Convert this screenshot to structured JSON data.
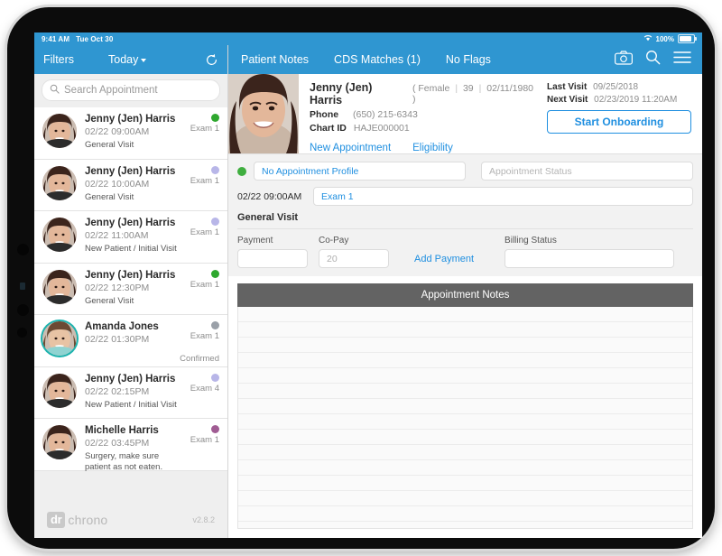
{
  "status_bar": {
    "time": "9:41 AM",
    "date": "Tue Oct 30",
    "wifi_icon": "wifi-icon",
    "battery_percent": "100%"
  },
  "sidebar": {
    "toolbar": {
      "filters_label": "Filters",
      "today_label": "Today",
      "chevron_icon": "chevron-down-icon",
      "refresh_icon": "refresh-icon"
    },
    "search": {
      "placeholder": "Search Appointment",
      "value": "",
      "icon": "search-icon"
    },
    "appointments": [
      {
        "name": "Jenny (Jen) Harris",
        "time": "02/22 09:00AM",
        "reason": "General Visit",
        "room": "Exam 1",
        "status_color": "#2fa82f",
        "confirmed": "",
        "avatar": "patient-avatar",
        "selected": false
      },
      {
        "name": "Jenny (Jen) Harris",
        "time": "02/22 10:00AM",
        "reason": "General Visit",
        "room": "Exam 1",
        "status_color": "#b8b6e8",
        "confirmed": "",
        "avatar": "patient-avatar",
        "selected": false
      },
      {
        "name": "Jenny (Jen) Harris",
        "time": "02/22 11:00AM",
        "reason": "New Patient / Initial Visit",
        "room": "Exam 1",
        "status_color": "#b8b6e8",
        "confirmed": "",
        "avatar": "patient-avatar",
        "selected": false
      },
      {
        "name": "Jenny (Jen) Harris",
        "time": "02/22 12:30PM",
        "reason": "General Visit",
        "room": "Exam 1",
        "status_color": "#2fa82f",
        "confirmed": "",
        "avatar": "patient-avatar",
        "selected": false
      },
      {
        "name": "Amanda Jones",
        "time": "02/22 01:30PM",
        "reason": "",
        "room": "Exam 1",
        "status_color": "#9aa0a8",
        "confirmed": "Confirmed",
        "avatar": "patient-avatar-ringed",
        "selected": true
      },
      {
        "name": "Jenny (Jen) Harris",
        "time": "02/22 02:15PM",
        "reason": "New Patient / Initial Visit",
        "room": "Exam 4",
        "status_color": "#b8b6e8",
        "confirmed": "",
        "avatar": "patient-avatar",
        "selected": false
      },
      {
        "name": "Michelle Harris",
        "time": "02/22 03:45PM",
        "reason": "Surgery, make sure\npatient as not eaten.",
        "room": "Exam 1",
        "status_color": "#a05c93",
        "confirmed": "",
        "avatar": "patient-avatar",
        "selected": false
      }
    ],
    "footer": {
      "logo_dr": "dr",
      "logo_chrono": "chrono",
      "version": "v2.8.2"
    }
  },
  "main": {
    "toolbar": {
      "tabs": [
        {
          "label": "Patient Notes"
        },
        {
          "label": "CDS Matches (1)"
        },
        {
          "label": "No Flags"
        }
      ],
      "camera_icon": "camera-icon",
      "search_icon": "search-icon",
      "menu_icon": "hamburger-menu-icon"
    },
    "patient": {
      "photo": "patient-photo",
      "name": "Jenny (Jen) Harris",
      "demographics_open": "(",
      "gender": "Female",
      "age": "39",
      "dob": "02/11/1980",
      "demographics_close": ")",
      "phone_label": "Phone",
      "phone_value": "(650) 215-6343",
      "chart_label": "Chart ID",
      "chart_value": "HAJE000001",
      "new_appointment_link": "New Appointment",
      "eligibility_link": "Eligibility",
      "last_visit_label": "Last Visit",
      "last_visit_value": "09/25/2018",
      "next_visit_label": "Next Visit",
      "next_visit_value": "02/23/2019 11:20AM",
      "onboarding_button": "Start Onboarding"
    },
    "appointment": {
      "profile_value": "No Appointment Profile",
      "status_placeholder": "Appointment Status",
      "status_value": "",
      "status_dot_color": "#3fae3f",
      "datetime": "02/22 09:00AM",
      "room_value": "Exam 1"
    },
    "visit": {
      "title": "General Visit",
      "payment_label": "Payment",
      "payment_value": "",
      "copay_label": "Co-Pay",
      "copay_value": "20",
      "add_payment_link": "Add Payment",
      "billing_label": "Billing Status",
      "billing_value": ""
    },
    "notes": {
      "header": "Appointment Notes",
      "body": ""
    }
  },
  "colors": {
    "accent_blue": "#2f96d1",
    "link_blue": "#1f8fe0",
    "notes_header_gray": "#636363",
    "ring_teal": "#1cb3ae"
  }
}
